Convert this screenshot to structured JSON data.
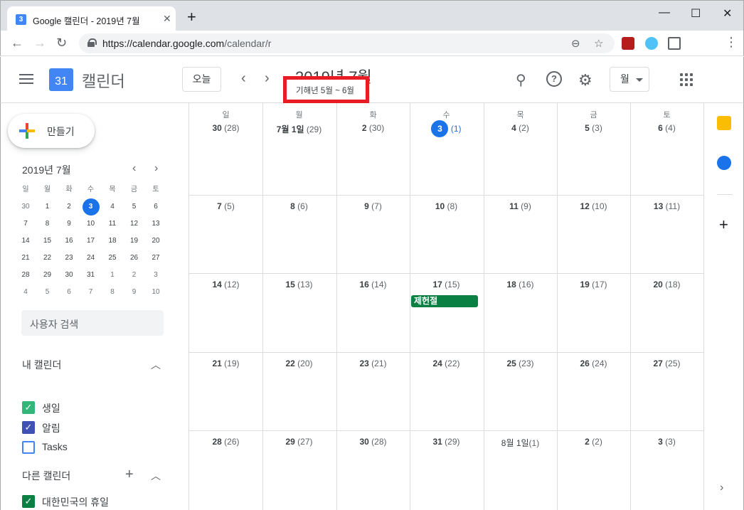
{
  "browser": {
    "tab_title": "Google 캘린더 - 2019년 7월",
    "tab_favicon_text": "3",
    "url_host": "https://calendar.google.com",
    "url_path": "/calendar/r",
    "new_tab": "+",
    "minimize": "—",
    "maximize": "☐",
    "close": "✕"
  },
  "header": {
    "app_name": "캘린더",
    "logo_number": "31",
    "today_label": "오늘",
    "month_title": "2019년 7월",
    "lunar_range": "기해년 5월 ~ 6월",
    "view_label": "월"
  },
  "sidebar": {
    "create_label": "만들기",
    "mini_title": "2019년 7월",
    "mini_dow": [
      "일",
      "월",
      "화",
      "수",
      "목",
      "금",
      "토"
    ],
    "mini_weeks": [
      [
        "30",
        "1",
        "2",
        "3",
        "4",
        "5",
        "6"
      ],
      [
        "7",
        "8",
        "9",
        "10",
        "11",
        "12",
        "13"
      ],
      [
        "14",
        "15",
        "16",
        "17",
        "18",
        "19",
        "20"
      ],
      [
        "21",
        "22",
        "23",
        "24",
        "25",
        "26",
        "27"
      ],
      [
        "28",
        "29",
        "30",
        "31",
        "1",
        "2",
        "3"
      ],
      [
        "4",
        "5",
        "6",
        "7",
        "8",
        "9",
        "10"
      ]
    ],
    "search_people_placeholder": "사용자 검색",
    "my_calendars_title": "내 캘린더",
    "my_calendars": [
      {
        "label": "생일",
        "color": "#33b679",
        "checked": true
      },
      {
        "label": "알림",
        "color": "#3f51b5",
        "checked": true
      },
      {
        "label": "Tasks",
        "color": "#4285f4",
        "checked": false
      }
    ],
    "other_calendars_title": "다른 캘린더",
    "other_calendars": [
      {
        "label": "대한민국의 휴일",
        "color": "#0b8043",
        "checked": true
      }
    ]
  },
  "grid": {
    "dow": [
      "일",
      "월",
      "화",
      "수",
      "목",
      "금",
      "토"
    ],
    "weeks": [
      [
        {
          "day": "30",
          "lunar": "(28)"
        },
        {
          "day": "7월 1일",
          "lunar": "(29)"
        },
        {
          "day": "2",
          "lunar": "(30)"
        },
        {
          "day": "3",
          "lunar": "(1)"
        },
        {
          "day": "4",
          "lunar": "(2)"
        },
        {
          "day": "5",
          "lunar": "(3)"
        },
        {
          "day": "6",
          "lunar": "(4)"
        }
      ],
      [
        {
          "day": "7",
          "lunar": "(5)"
        },
        {
          "day": "8",
          "lunar": "(6)"
        },
        {
          "day": "9",
          "lunar": "(7)"
        },
        {
          "day": "10",
          "lunar": "(8)"
        },
        {
          "day": "11",
          "lunar": "(9)"
        },
        {
          "day": "12",
          "lunar": "(10)"
        },
        {
          "day": "13",
          "lunar": "(11)"
        }
      ],
      [
        {
          "day": "14",
          "lunar": "(12)"
        },
        {
          "day": "15",
          "lunar": "(13)"
        },
        {
          "day": "16",
          "lunar": "(14)"
        },
        {
          "day": "17",
          "lunar": "(15)"
        },
        {
          "day": "18",
          "lunar": "(16)"
        },
        {
          "day": "19",
          "lunar": "(17)"
        },
        {
          "day": "20",
          "lunar": "(18)"
        }
      ],
      [
        {
          "day": "21",
          "lunar": "(19)"
        },
        {
          "day": "22",
          "lunar": "(20)"
        },
        {
          "day": "23",
          "lunar": "(21)"
        },
        {
          "day": "24",
          "lunar": "(22)"
        },
        {
          "day": "25",
          "lunar": "(23)"
        },
        {
          "day": "26",
          "lunar": "(24)"
        },
        {
          "day": "27",
          "lunar": "(25)"
        }
      ],
      [
        {
          "day": "28",
          "lunar": "(26)"
        },
        {
          "day": "29",
          "lunar": "(27)"
        },
        {
          "day": "30",
          "lunar": "(28)"
        },
        {
          "day": "31",
          "lunar": "(29)"
        },
        {
          "day": "8월 1일",
          "lunar": "(1)"
        },
        {
          "day": "2",
          "lunar": "(2)"
        },
        {
          "day": "3",
          "lunar": "(3)"
        }
      ]
    ],
    "event": {
      "title": "제헌절",
      "color": "#0b8043"
    }
  },
  "colors": {
    "accent": "#1a73e8",
    "highlight_box": "#e81c24",
    "keep_yellow": "#fbbc04",
    "tasks_blue": "#1a73e8"
  }
}
